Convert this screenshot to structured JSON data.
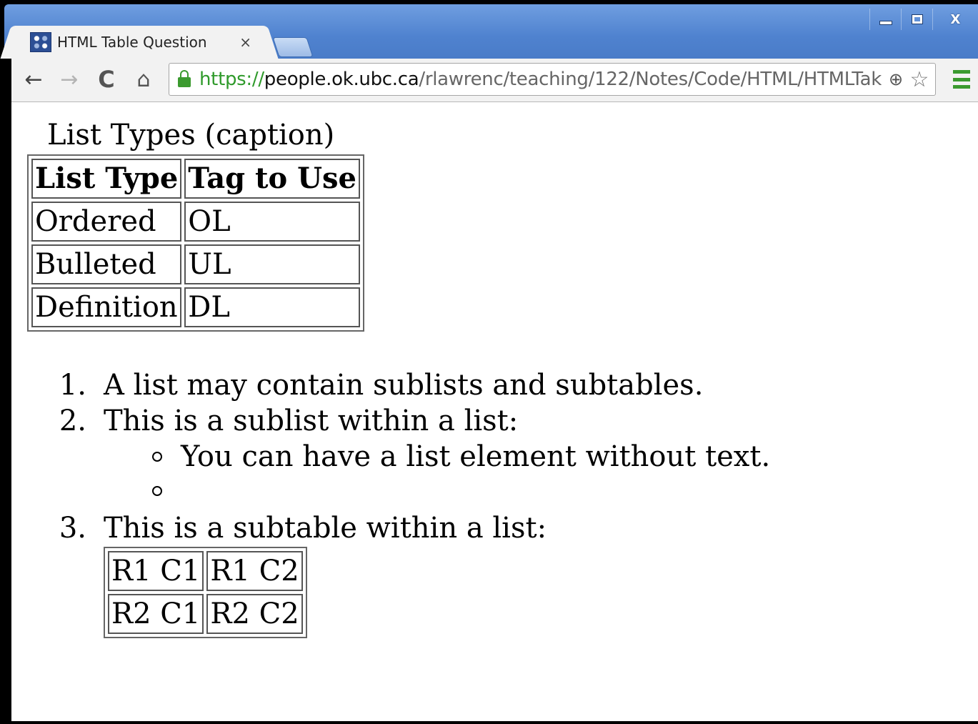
{
  "window": {
    "minimize_label": "",
    "maximize_label": "",
    "close_label": "X"
  },
  "tab": {
    "title": "HTML Table Question",
    "close": "×"
  },
  "toolbar": {
    "back": "←",
    "forward": "→",
    "reload": "C",
    "home": "⌂",
    "url_scheme": "https://",
    "url_host": "people.ok.ubc.ca",
    "url_path": "/rlawrenc/teaching/122/Notes/Code/HTML/HTMLTak",
    "zoom": "⊕",
    "star": "☆"
  },
  "page": {
    "caption": "List Types (caption)",
    "table": {
      "headers": [
        "List Type",
        "Tag to Use"
      ],
      "rows": [
        [
          "Ordered",
          "OL"
        ],
        [
          "Bulleted",
          "UL"
        ],
        [
          "Definition",
          "DL"
        ]
      ]
    },
    "list": [
      {
        "num": "1.",
        "text": "A list may contain sublists and subtables."
      },
      {
        "num": "2.",
        "text": "This is a sublist within a list:"
      },
      {
        "num": "3.",
        "text": "This is a subtable within a list:"
      }
    ],
    "sublist": [
      "You can have a list element without text.",
      ""
    ],
    "subtable": [
      [
        "R1 C1",
        "R1 C2"
      ],
      [
        "R2 C1",
        "R2 C2"
      ]
    ]
  },
  "colors": {
    "titlebar": "#4f82cf",
    "secure_green": "#2f9a2b",
    "menu_green": "#3b9a2f"
  },
  "icons": {
    "favicon": "site-favicon",
    "lock": "lock-icon",
    "zoom": "zoom-icon",
    "bookmark": "star-icon",
    "menu": "hamburger-menu-icon"
  }
}
